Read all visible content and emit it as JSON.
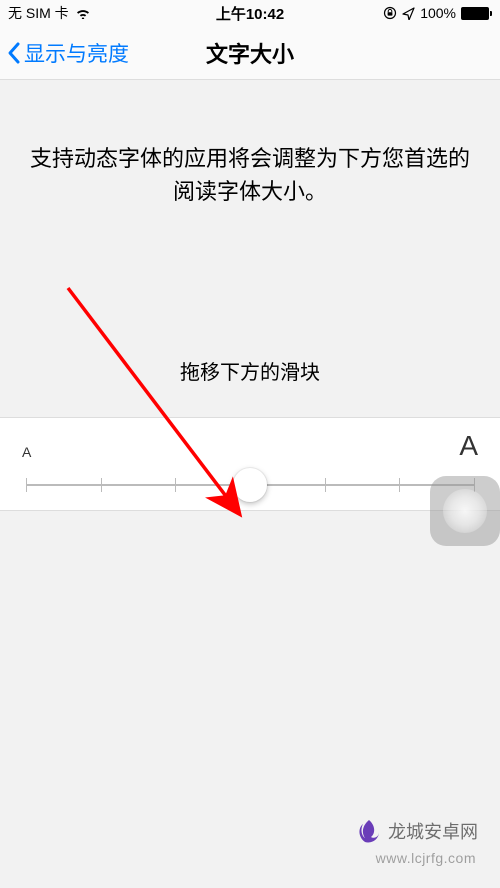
{
  "status_bar": {
    "carrier": "无 SIM 卡",
    "time": "上午10:42",
    "battery_pct": "100%"
  },
  "nav": {
    "back_label": "显示与亮度",
    "title": "文字大小"
  },
  "body": {
    "description": "支持动态字体的应用将会调整为下方您首选的阅读字体大小。",
    "instruction": "拖移下方的滑块"
  },
  "slider": {
    "min_label": "A",
    "max_label": "A",
    "ticks": 7,
    "value_index": 3
  },
  "icons": {
    "wifi": "wifi-icon",
    "orientation_lock": "orientation-lock-icon",
    "location": "location-arrow-icon",
    "back_chevron": "chevron-left-icon",
    "assistive_touch": "assistive-touch-button"
  },
  "watermark": {
    "brand": "龙城安卓网",
    "url": "www.lcjrfg.com"
  },
  "colors": {
    "tint": "#007aff",
    "annotation": "#ff0000"
  }
}
